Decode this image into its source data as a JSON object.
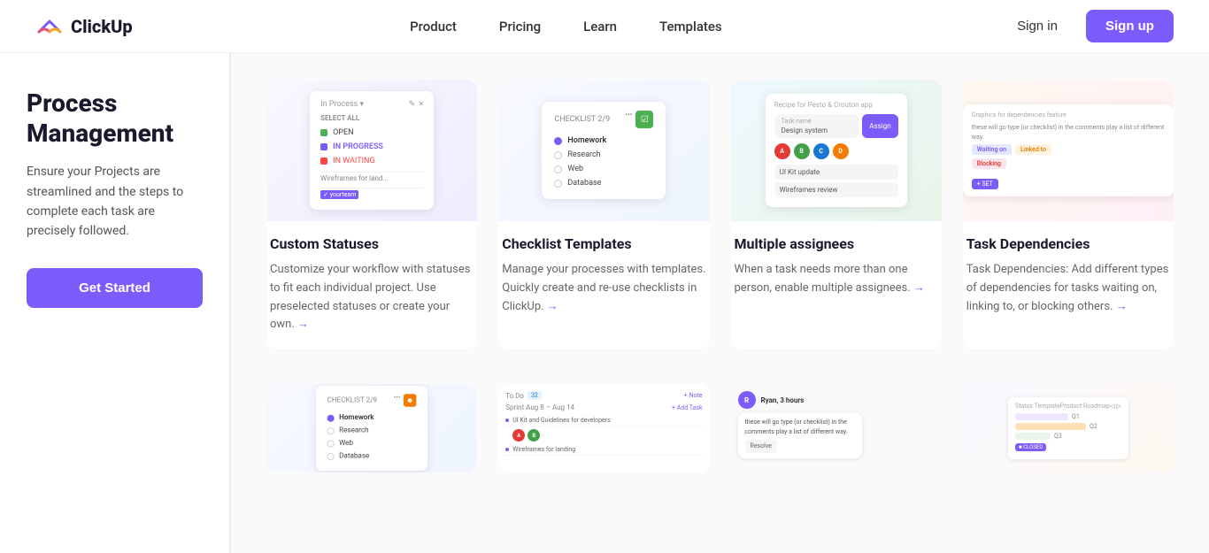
{
  "nav": {
    "logo_text": "ClickUp",
    "links": [
      {
        "label": "Product",
        "id": "product"
      },
      {
        "label": "Pricing",
        "id": "pricing"
      },
      {
        "label": "Learn",
        "id": "learn"
      },
      {
        "label": "Templates",
        "id": "templates"
      }
    ],
    "signin_label": "Sign in",
    "signup_label": "Sign up"
  },
  "sidebar": {
    "title": "Process Management",
    "description": "Ensure your Projects are streamlined and the steps to complete each task are precisely followed.",
    "cta_label": "Get Started"
  },
  "features": [
    {
      "id": "custom-statuses",
      "title": "Custom Statuses",
      "description": "Customize your workflow with statuses to fit each individual project. Use preselected statuses or create your own.",
      "link_text": "→"
    },
    {
      "id": "checklist-templates",
      "title": "Checklist Templates",
      "description": "Manage your processes with templates. Quickly create and re-use checklists in ClickUp.",
      "link_text": "→"
    },
    {
      "id": "multiple-assignees",
      "title": "Multiple assignees",
      "description": "When a task needs more than one person, enable multiple assignees.",
      "link_text": "→"
    },
    {
      "id": "task-dependencies",
      "title": "Task Dependencies",
      "description": "Task Dependencies: Add different types of dependencies for tasks waiting on, linking to, or blocking others.",
      "link_text": "→"
    }
  ],
  "features_bottom": [
    {
      "id": "checklist-2",
      "title": ""
    },
    {
      "id": "sprint",
      "title": ""
    },
    {
      "id": "comments",
      "title": ""
    },
    {
      "id": "roadmap",
      "title": ""
    }
  ],
  "mock": {
    "checklist_header": "CHECKLIST 2/9",
    "checklist_items": [
      "Homework",
      "Research",
      "Web",
      "Database"
    ],
    "sprint_header": "Sprint Aug 8 – Aug 14",
    "sprint_tasks": [
      "UI Kit and Guidelines for developers",
      "Wireframes for landing"
    ],
    "statuses": [
      "OPEN",
      "IN PROGRESS",
      "IN WAITING"
    ],
    "status_header": "Select All",
    "dep_tags": [
      "Waiting on",
      "Linked to",
      "Blocking"
    ],
    "roadmap_title": "Status Template",
    "roadmap_subtitle": "Product Roadmap"
  }
}
